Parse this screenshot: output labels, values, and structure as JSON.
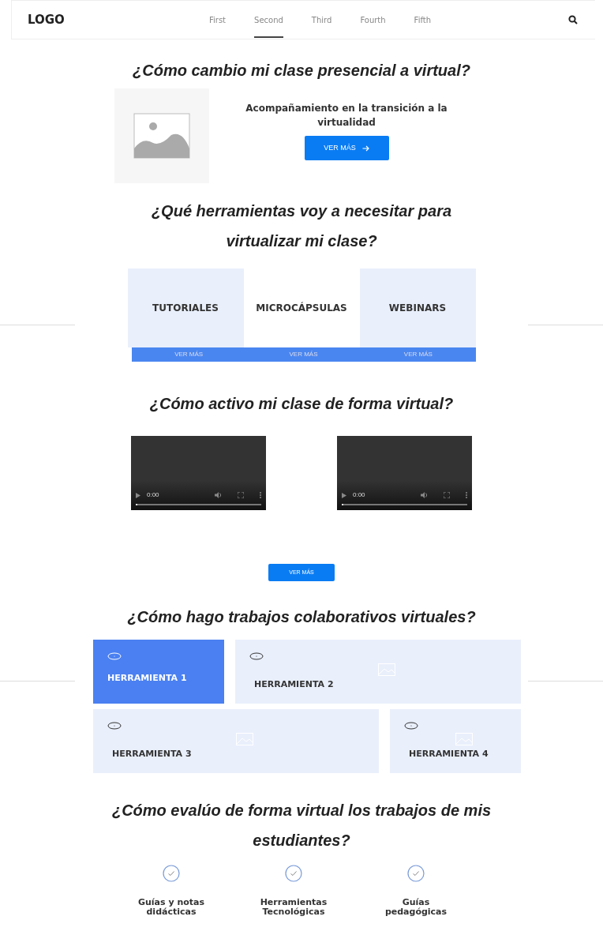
{
  "navbar": {
    "logo": "LOGO",
    "items": [
      {
        "label": "First",
        "selected": false
      },
      {
        "label": "Second",
        "selected": true
      },
      {
        "label": "Third",
        "selected": false
      },
      {
        "label": "Fourth",
        "selected": false
      },
      {
        "label": "Fifth",
        "selected": false
      }
    ]
  },
  "section_1": {
    "title": "¿Cómo cambio mi clase presencial a virtual?",
    "subtitle": "Acompañamiento en la transición a la virtualidad",
    "button": "VER MÁS"
  },
  "section_2": {
    "title": "¿Qué herramientas voy a necesitar para virtualizar mi clase?",
    "cards": [
      {
        "label": "TUTORIALES",
        "button": "VER MÁS",
        "shaded": true
      },
      {
        "label": "MICROCÁPSULAS",
        "button": "VER MÁS",
        "shaded": false
      },
      {
        "label": "WEBINARS",
        "button": "VER MÁS",
        "shaded": true
      }
    ]
  },
  "section_3": {
    "title": "¿Cómo activo mi clase de forma virtual?",
    "videos": [
      {
        "time": "0:00",
        "level": 0
      },
      {
        "time": "0:00",
        "level": 0
      }
    ],
    "button": "VER MÁS"
  },
  "section_4": {
    "title": "¿Cómo hago trabajos colaborativos virtuales?",
    "tiles": [
      {
        "label": "HERRAMIENTA 1",
        "selected": true
      },
      {
        "label": "HERRAMIENTA 2",
        "selected": false
      },
      {
        "label": "HERRAMIENTA 3",
        "selected": false
      },
      {
        "label": "HERRAMIENTA 4",
        "selected": false
      }
    ]
  },
  "section_5": {
    "title": "¿Cómo evalúo de forma virtual los trabajos de mis estudiantes?",
    "items": [
      {
        "label": "Guías y notas didácticas"
      },
      {
        "label": "Herramientas Tecnológicas"
      },
      {
        "label": "Guías pedagógicas"
      }
    ]
  }
}
